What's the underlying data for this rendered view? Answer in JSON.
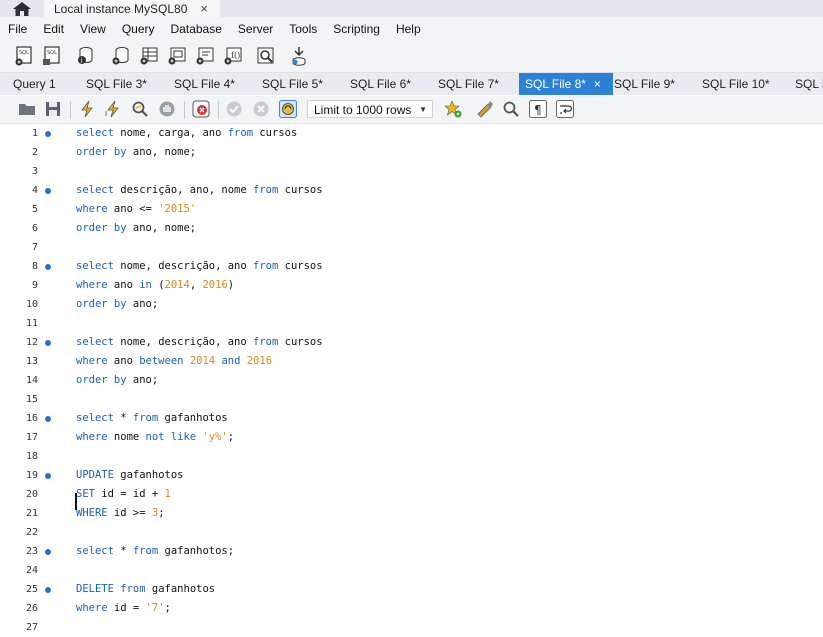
{
  "titlebar": {
    "instance_label": "Local instance MySQL80",
    "close_glyph": "×"
  },
  "menu": [
    "File",
    "Edit",
    "View",
    "Query",
    "Database",
    "Server",
    "Tools",
    "Scripting",
    "Help"
  ],
  "toolbar_icons": [
    "new-sql-tab-icon",
    "open-sql-script-icon",
    "schema-inspector-icon",
    "create-schema-icon",
    "create-table-icon",
    "create-view-icon",
    "create-procedure-icon",
    "create-function-icon",
    "search-table-data-icon",
    "reconnect-icon"
  ],
  "tabs": [
    {
      "label": "Query 1",
      "active": false
    },
    {
      "label": "SQL File 3*",
      "active": false
    },
    {
      "label": "SQL File 4*",
      "active": false
    },
    {
      "label": "SQL File 5*",
      "active": false
    },
    {
      "label": "SQL File 6*",
      "active": false
    },
    {
      "label": "SQL File 7*",
      "active": false
    },
    {
      "label": "SQL File 8*",
      "active": true
    },
    {
      "label": "SQL File 9*",
      "active": false
    },
    {
      "label": "SQL File 10*",
      "active": false
    },
    {
      "label": "SQL F",
      "active": false
    }
  ],
  "tab_close_glyph": "×",
  "editor_toolbar": {
    "limit_label": "Limit to 1000 rows"
  },
  "editor": {
    "lines": [
      {
        "n": "1",
        "marker": true,
        "tokens": [
          [
            "kw",
            "select"
          ],
          [
            "t",
            " nome, carga, ano "
          ],
          [
            "kw",
            "from"
          ],
          [
            "t",
            " cursos"
          ]
        ]
      },
      {
        "n": "2",
        "marker": false,
        "tokens": [
          [
            "kw",
            "order by"
          ],
          [
            "t",
            " ano, nome;"
          ]
        ]
      },
      {
        "n": "3",
        "marker": false,
        "tokens": []
      },
      {
        "n": "4",
        "marker": true,
        "tokens": [
          [
            "kw",
            "select"
          ],
          [
            "t",
            " descrição, ano, nome "
          ],
          [
            "kw",
            "from"
          ],
          [
            "t",
            " cursos"
          ]
        ]
      },
      {
        "n": "5",
        "marker": false,
        "tokens": [
          [
            "kw",
            "where"
          ],
          [
            "t",
            " ano <= "
          ],
          [
            "str",
            "'2015'"
          ]
        ]
      },
      {
        "n": "6",
        "marker": false,
        "tokens": [
          [
            "kw",
            "order by"
          ],
          [
            "t",
            " ano, nome;"
          ]
        ]
      },
      {
        "n": "7",
        "marker": false,
        "tokens": []
      },
      {
        "n": "8",
        "marker": true,
        "tokens": [
          [
            "kw",
            "select"
          ],
          [
            "t",
            " nome, descrição, ano "
          ],
          [
            "kw",
            "from"
          ],
          [
            "t",
            " cursos"
          ]
        ]
      },
      {
        "n": "9",
        "marker": false,
        "tokens": [
          [
            "kw",
            "where"
          ],
          [
            "t",
            " ano "
          ],
          [
            "kw",
            "in"
          ],
          [
            "t",
            " ("
          ],
          [
            "num",
            "2014"
          ],
          [
            "t",
            ", "
          ],
          [
            "num",
            "2016"
          ],
          [
            "t",
            ")"
          ]
        ]
      },
      {
        "n": "10",
        "marker": false,
        "tokens": [
          [
            "kw",
            "order by"
          ],
          [
            "t",
            " ano;"
          ]
        ]
      },
      {
        "n": "11",
        "marker": false,
        "tokens": []
      },
      {
        "n": "12",
        "marker": true,
        "tokens": [
          [
            "kw",
            "select"
          ],
          [
            "t",
            " nome, descrição, ano "
          ],
          [
            "kw",
            "from"
          ],
          [
            "t",
            " cursos"
          ]
        ]
      },
      {
        "n": "13",
        "marker": false,
        "tokens": [
          [
            "kw",
            "where"
          ],
          [
            "t",
            " ano "
          ],
          [
            "kw",
            "between"
          ],
          [
            "t",
            " "
          ],
          [
            "num",
            "2014"
          ],
          [
            "t",
            " "
          ],
          [
            "kw",
            "and"
          ],
          [
            "t",
            " "
          ],
          [
            "num",
            "2016"
          ]
        ]
      },
      {
        "n": "14",
        "marker": false,
        "tokens": [
          [
            "kw",
            "order by"
          ],
          [
            "t",
            " ano;"
          ]
        ]
      },
      {
        "n": "15",
        "marker": false,
        "tokens": []
      },
      {
        "n": "16",
        "marker": true,
        "tokens": [
          [
            "kw",
            "select"
          ],
          [
            "t",
            " * "
          ],
          [
            "kw",
            "from"
          ],
          [
            "t",
            " gafanhotos"
          ]
        ]
      },
      {
        "n": "17",
        "marker": false,
        "tokens": [
          [
            "kw",
            "where"
          ],
          [
            "t",
            " nome "
          ],
          [
            "kw",
            "not like"
          ],
          [
            "t",
            " "
          ],
          [
            "str",
            "'y%'"
          ],
          [
            "t",
            ";"
          ]
        ]
      },
      {
        "n": "18",
        "marker": false,
        "tokens": []
      },
      {
        "n": "19",
        "marker": true,
        "tokens": [
          [
            "kw",
            "UPDATE"
          ],
          [
            "t",
            " gafanhotos"
          ]
        ]
      },
      {
        "n": "20",
        "marker": false,
        "tokens": [
          [
            "kw",
            "SET"
          ],
          [
            "t",
            " id = id + "
          ],
          [
            "num",
            "1"
          ]
        ]
      },
      {
        "n": "21",
        "marker": false,
        "tokens": [
          [
            "kw",
            "WHERE"
          ],
          [
            "t",
            " id >= "
          ],
          [
            "num",
            "3"
          ],
          [
            "t",
            ";"
          ]
        ]
      },
      {
        "n": "22",
        "marker": false,
        "tokens": []
      },
      {
        "n": "23",
        "marker": true,
        "tokens": [
          [
            "kw",
            "select"
          ],
          [
            "t",
            " * "
          ],
          [
            "kw",
            "from"
          ],
          [
            "t",
            " gafanhotos;"
          ]
        ]
      },
      {
        "n": "24",
        "marker": false,
        "tokens": []
      },
      {
        "n": "25",
        "marker": true,
        "tokens": [
          [
            "kw",
            "DELETE"
          ],
          [
            "t",
            " "
          ],
          [
            "kw",
            "from"
          ],
          [
            "t",
            " gafanhotos"
          ]
        ]
      },
      {
        "n": "26",
        "marker": false,
        "tokens": [
          [
            "kw",
            "where"
          ],
          [
            "t",
            " id = "
          ],
          [
            "str",
            "'7'"
          ],
          [
            "t",
            ";"
          ]
        ]
      },
      {
        "n": "27",
        "marker": false,
        "tokens": []
      }
    ]
  },
  "colors": {
    "keyword": "#1c5fb8",
    "string": "#d48a1a",
    "active_tab": "#2c81d6",
    "marker": "#1f74c9"
  }
}
